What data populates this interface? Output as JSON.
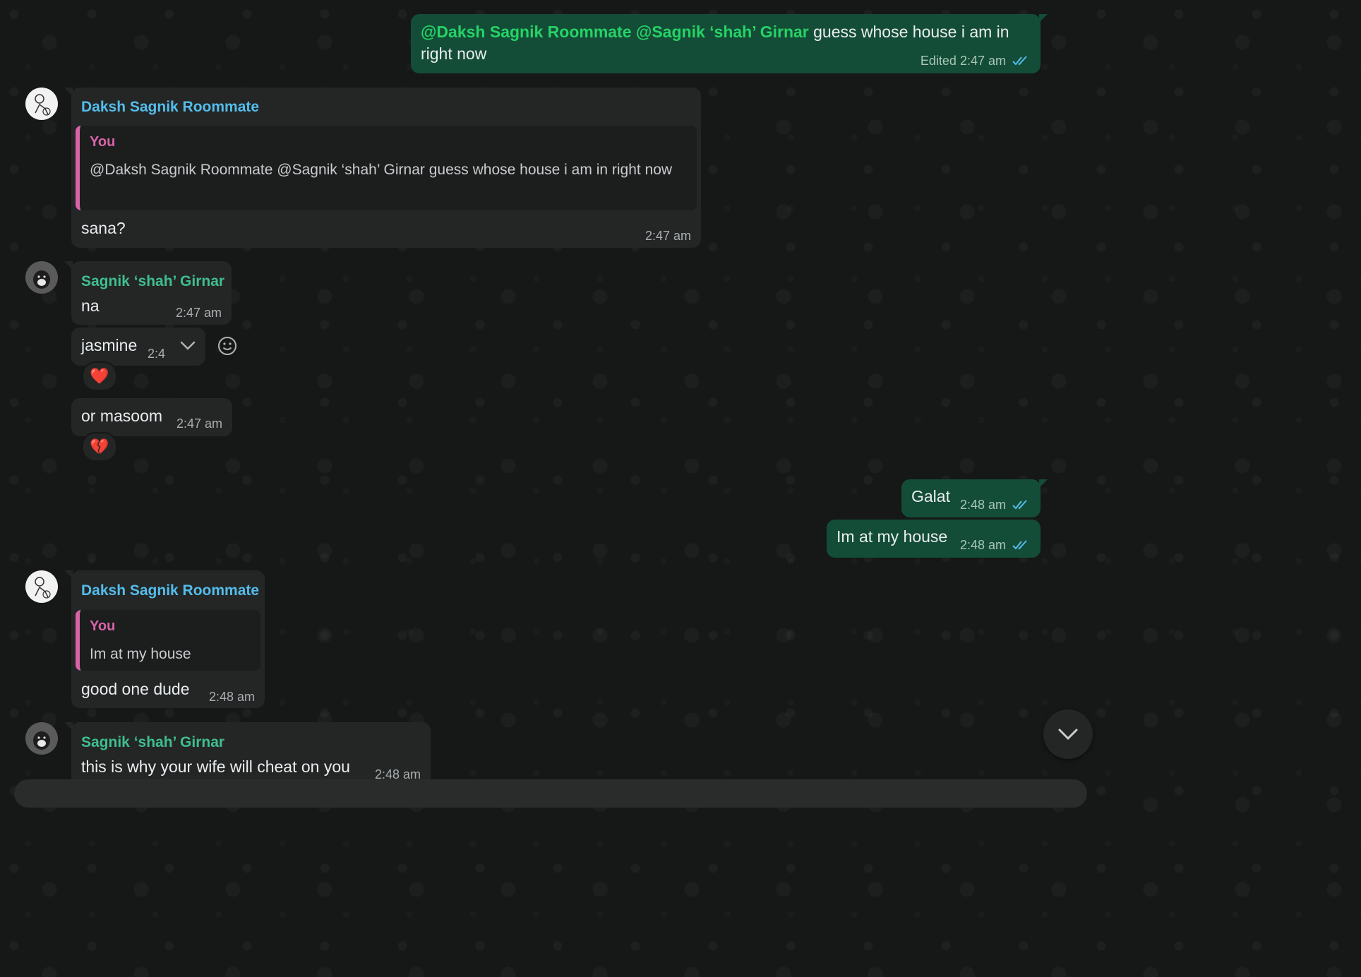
{
  "messages": {
    "m1": {
      "mention1": "@Daksh Sagnik Roommate",
      "mention2": "@Sagnik ‘shah’ Girnar",
      "text_line1": "guess whose house i am in",
      "text_line2": "right now",
      "edited_label": "Edited",
      "time": "2:47 am"
    },
    "m2": {
      "sender": "Daksh Sagnik Roommate",
      "quote_sender": "You",
      "quote_text": "@Daksh Sagnik Roommate @Sagnik ‘shah’ Girnar guess whose house i am in right now",
      "text": "sana?",
      "time": "2:47 am"
    },
    "m3": {
      "sender": "Sagnik ‘shah’ Girnar",
      "text": "na",
      "time": "2:47 am"
    },
    "m4": {
      "text": "jasmine",
      "time": "2:4",
      "reaction": "❤️"
    },
    "m5": {
      "text": "or masoom",
      "time": "2:47 am",
      "reaction": "💔"
    },
    "m6": {
      "text": "Galat",
      "time": "2:48 am"
    },
    "m7": {
      "text": "Im at my house",
      "time": "2:48 am"
    },
    "m8": {
      "sender": "Daksh Sagnik Roommate",
      "quote_sender": "You",
      "quote_text": "Im at my house",
      "text": "good one dude",
      "time": "2:48 am"
    },
    "m9": {
      "sender": "Sagnik ‘shah’ Girnar",
      "text": "this is why your wife will cheat on you",
      "time": "2:48 am"
    }
  },
  "colors": {
    "background": "#161717",
    "incoming_bubble": "#242626",
    "outgoing_bubble": "#144d37",
    "quote_accent": "#d864a8",
    "sender_blue": "#53bdeb",
    "sender_green": "#25d366",
    "read_ticks": "#53bdeb"
  },
  "icons": {
    "read_receipt": "double-check-icon",
    "message_menu": "chevron-down-icon",
    "react": "smiley-icon",
    "scroll_down": "chevron-down-icon"
  }
}
